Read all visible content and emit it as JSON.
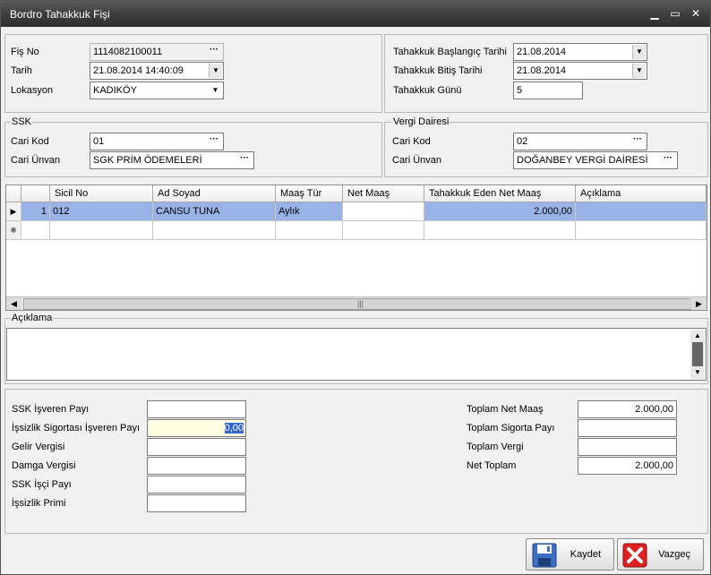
{
  "window": {
    "title": "Bordro Tahakkuk Fişi",
    "min_icon": "minimize-icon",
    "max_icon": "maximize-icon",
    "close_icon": "close-icon"
  },
  "header_left": {
    "fis_no_label": "Fiş No",
    "fis_no_value": "1114082100011",
    "tarih_label": "Tarih",
    "tarih_value": "21.08.2014 14:40:09",
    "lokasyon_label": "Lokasyon",
    "lokasyon_value": "KADIKÖY"
  },
  "header_right": {
    "baslangic_label": "Tahakkuk Başlangıç Tarihi",
    "baslangic_value": "21.08.2014",
    "bitis_label": "Tahakkuk Bitiş Tarihi",
    "bitis_value": "21.08.2014",
    "gun_label": "Tahakkuk Günü",
    "gun_value": "5"
  },
  "ssk": {
    "group_label": "SSK",
    "cari_kod_label": "Cari Kod",
    "cari_kod_value": "01",
    "cari_unvan_label": "Cari Ünvan",
    "cari_unvan_value": "SGK PRİM ÖDEMELERİ"
  },
  "vergi": {
    "group_label": "Vergi Dairesi",
    "cari_kod_label": "Cari Kod",
    "cari_kod_value": "02",
    "cari_unvan_label": "Cari Ünvan",
    "cari_unvan_value": "DOĞANBEY VERGİ DAİRESİ"
  },
  "grid": {
    "columns": [
      "Sicil No",
      "Ad Soyad",
      "Maaş Tür",
      "Net Maaş",
      "Tahakkuk Eden Net Maaş",
      "Açıklama"
    ],
    "rows": [
      {
        "row_no": "1",
        "sicil_no": "012",
        "ad_soyad": "CANSU TUNA",
        "maas_tur": "Aylık",
        "net_maas": "",
        "tahakkuk_net": "2.000,00",
        "aciklama": ""
      }
    ]
  },
  "aciklama": {
    "group_label": "Açıklama",
    "value": ""
  },
  "bottom_left": {
    "ssk_isveren_label": "SSK İşveren Payı",
    "ssk_isveren_value": "",
    "issizlik_isveren_label": "İşsizlik Sigortası İşveren Payı",
    "issizlik_isveren_value": "0,00",
    "gelir_vergisi_label": "Gelir Vergisi",
    "gelir_vergisi_value": "",
    "damga_vergisi_label": "Damga Vergisi",
    "damga_vergisi_value": "",
    "ssk_isci_label": "SSK İşçi Payı",
    "ssk_isci_value": "",
    "issizlik_primi_label": "İşsizlik Primi",
    "issizlik_primi_value": ""
  },
  "bottom_right": {
    "toplam_net_label": "Toplam Net Maaş",
    "toplam_net_value": "2.000,00",
    "toplam_sigorta_label": "Toplam Sigorta Payı",
    "toplam_sigorta_value": "",
    "toplam_vergi_label": "Toplam Vergi",
    "toplam_vergi_value": "",
    "net_toplam_label": "Net Toplam",
    "net_toplam_value": "2.000,00"
  },
  "buttons": {
    "save_label": "Kaydet",
    "save_icon": "floppy-disk-icon",
    "cancel_label": "Vazgeç",
    "cancel_icon": "red-x-icon"
  },
  "colors": {
    "titlebar": "#3e3e3e",
    "selection": "#99b3e6",
    "highlight_field": "#ffffe1",
    "selected_text": "#3366cc"
  }
}
